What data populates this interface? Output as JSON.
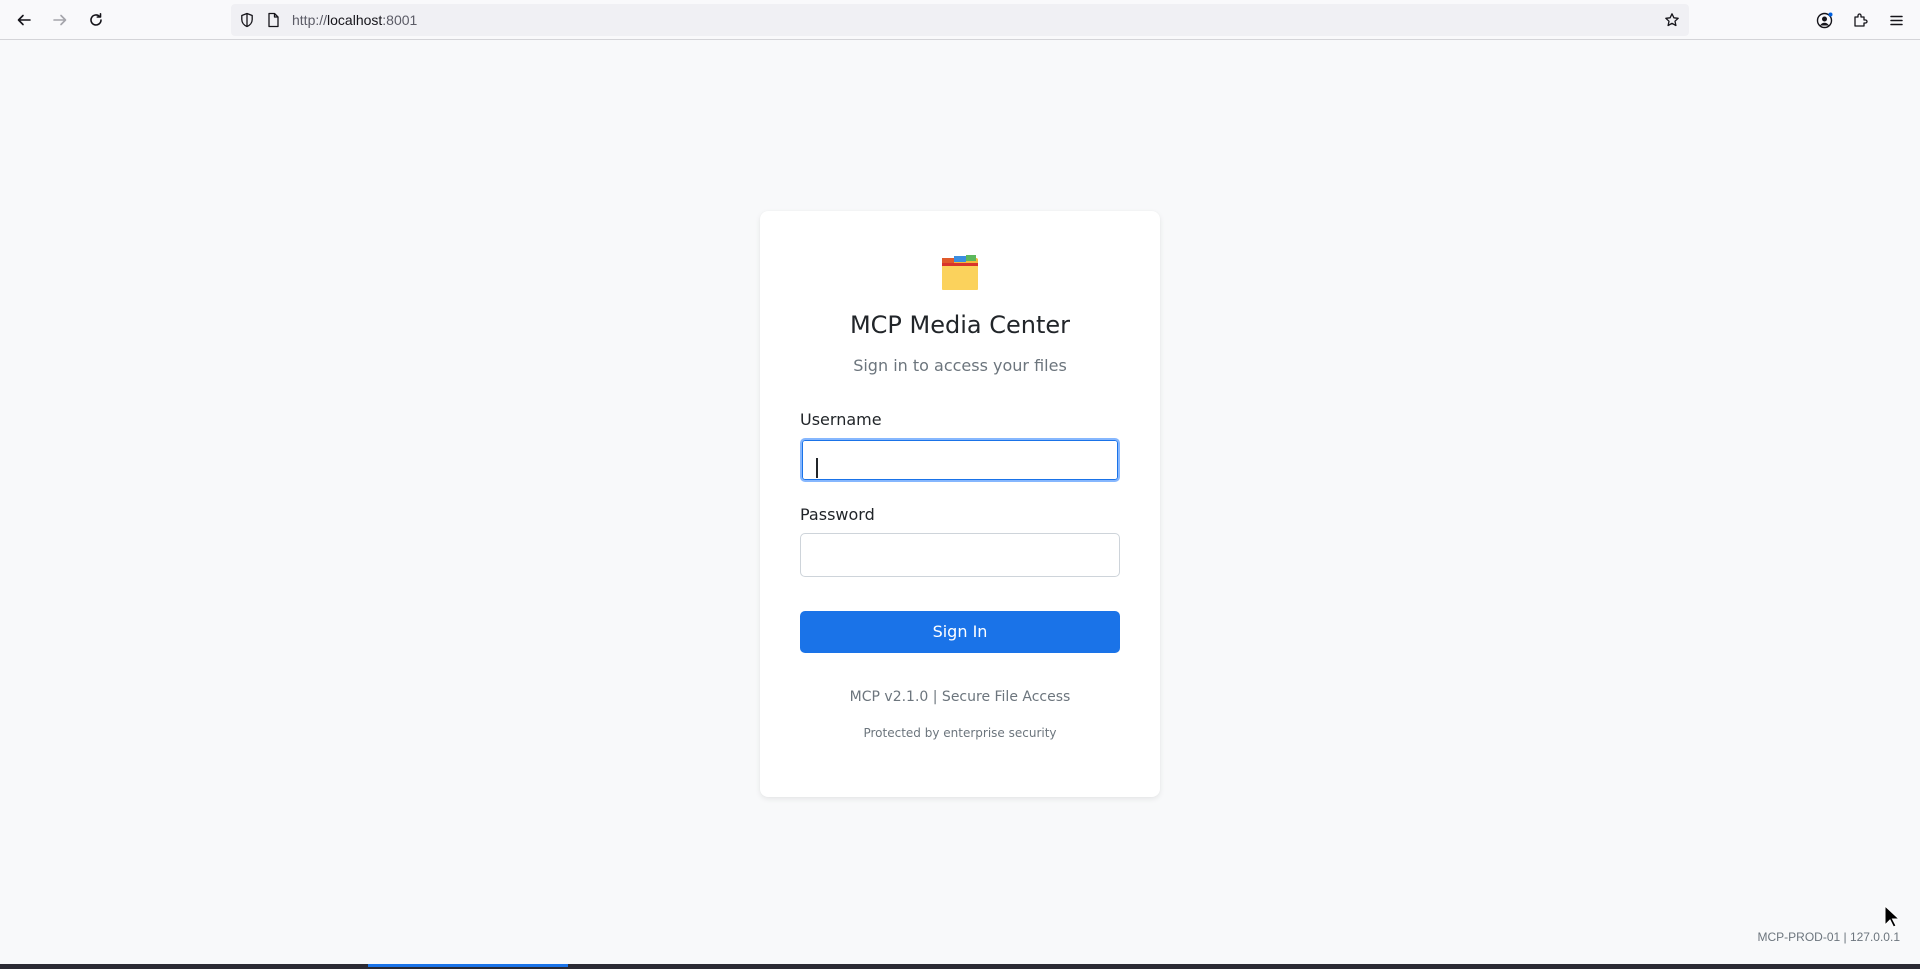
{
  "browser": {
    "url_prefix": "http://",
    "url_host": "localhost",
    "url_port": ":8001"
  },
  "login": {
    "title": "MCP Media Center",
    "subtitle": "Sign in to access your files",
    "username_label": "Username",
    "username_value": "",
    "password_label": "Password",
    "password_value": "",
    "submit_label": "Sign In",
    "version_line": "MCP v2.1.0 | Secure File Access",
    "security_line": "Protected by enterprise security"
  },
  "footer": {
    "server_info": "MCP-PROD-01 | 127.0.0.1"
  },
  "colors": {
    "accent": "#1a73e8",
    "page_bg": "#f8f9fa",
    "muted_text": "#6c757d"
  }
}
